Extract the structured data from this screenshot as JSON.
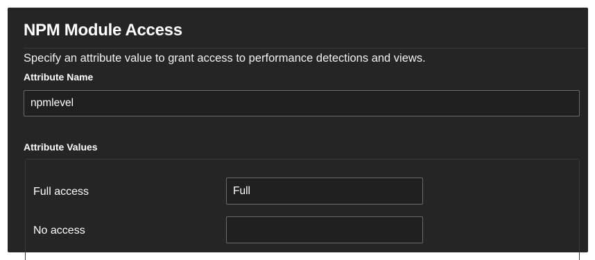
{
  "section": {
    "title": "NPM Module Access",
    "description": "Specify an attribute value to grant access to performance detections and views."
  },
  "attribute_name": {
    "label": "Attribute Name",
    "value": "npmlevel"
  },
  "attribute_values": {
    "label": "Attribute Values",
    "rows": [
      {
        "label": "Full access",
        "value": "Full"
      },
      {
        "label": "No access",
        "value": ""
      }
    ]
  }
}
